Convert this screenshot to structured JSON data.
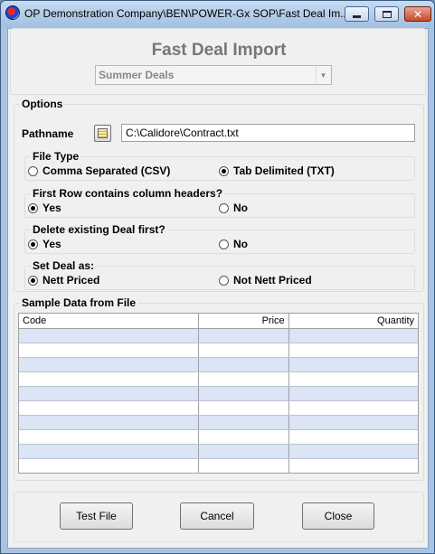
{
  "window": {
    "title": "OP Demonstration Company\\BEN\\POWER-Gx SOP\\Fast Deal Im...",
    "close_glyph": "✕"
  },
  "header": {
    "title": "Fast Deal Import",
    "deal_combo_value": "Summer Deals",
    "combo_arrow": "▼"
  },
  "options": {
    "label": "Options",
    "pathname_label": "Pathname",
    "pathname_value": "C:\\Calidore\\Contract.txt",
    "file_type": {
      "label": "File Type",
      "opt1": "Comma Separated (CSV)",
      "opt2": "Tab Delimited (TXT)",
      "selected": "opt2"
    },
    "headers": {
      "label": "First Row contains column headers?",
      "yes": "Yes",
      "no": "No",
      "selected": "yes"
    },
    "delete_deal": {
      "label": "Delete existing Deal first?",
      "yes": "Yes",
      "no": "No",
      "selected": "yes"
    },
    "set_deal": {
      "label": "Set Deal as:",
      "opt1": "Nett Priced",
      "opt2": "Not Nett Priced",
      "selected": "opt1"
    }
  },
  "sample": {
    "label": "Sample Data from File",
    "columns": [
      "Code",
      "Price",
      "Quantity"
    ],
    "rows": [
      [
        "",
        "",
        ""
      ],
      [
        "",
        "",
        ""
      ],
      [
        "",
        "",
        ""
      ],
      [
        "",
        "",
        ""
      ],
      [
        "",
        "",
        ""
      ],
      [
        "",
        "",
        ""
      ],
      [
        "",
        "",
        ""
      ],
      [
        "",
        "",
        ""
      ],
      [
        "",
        "",
        ""
      ],
      [
        "",
        "",
        ""
      ]
    ]
  },
  "buttons": {
    "test": "Test File",
    "cancel": "Cancel",
    "close": "Close"
  }
}
